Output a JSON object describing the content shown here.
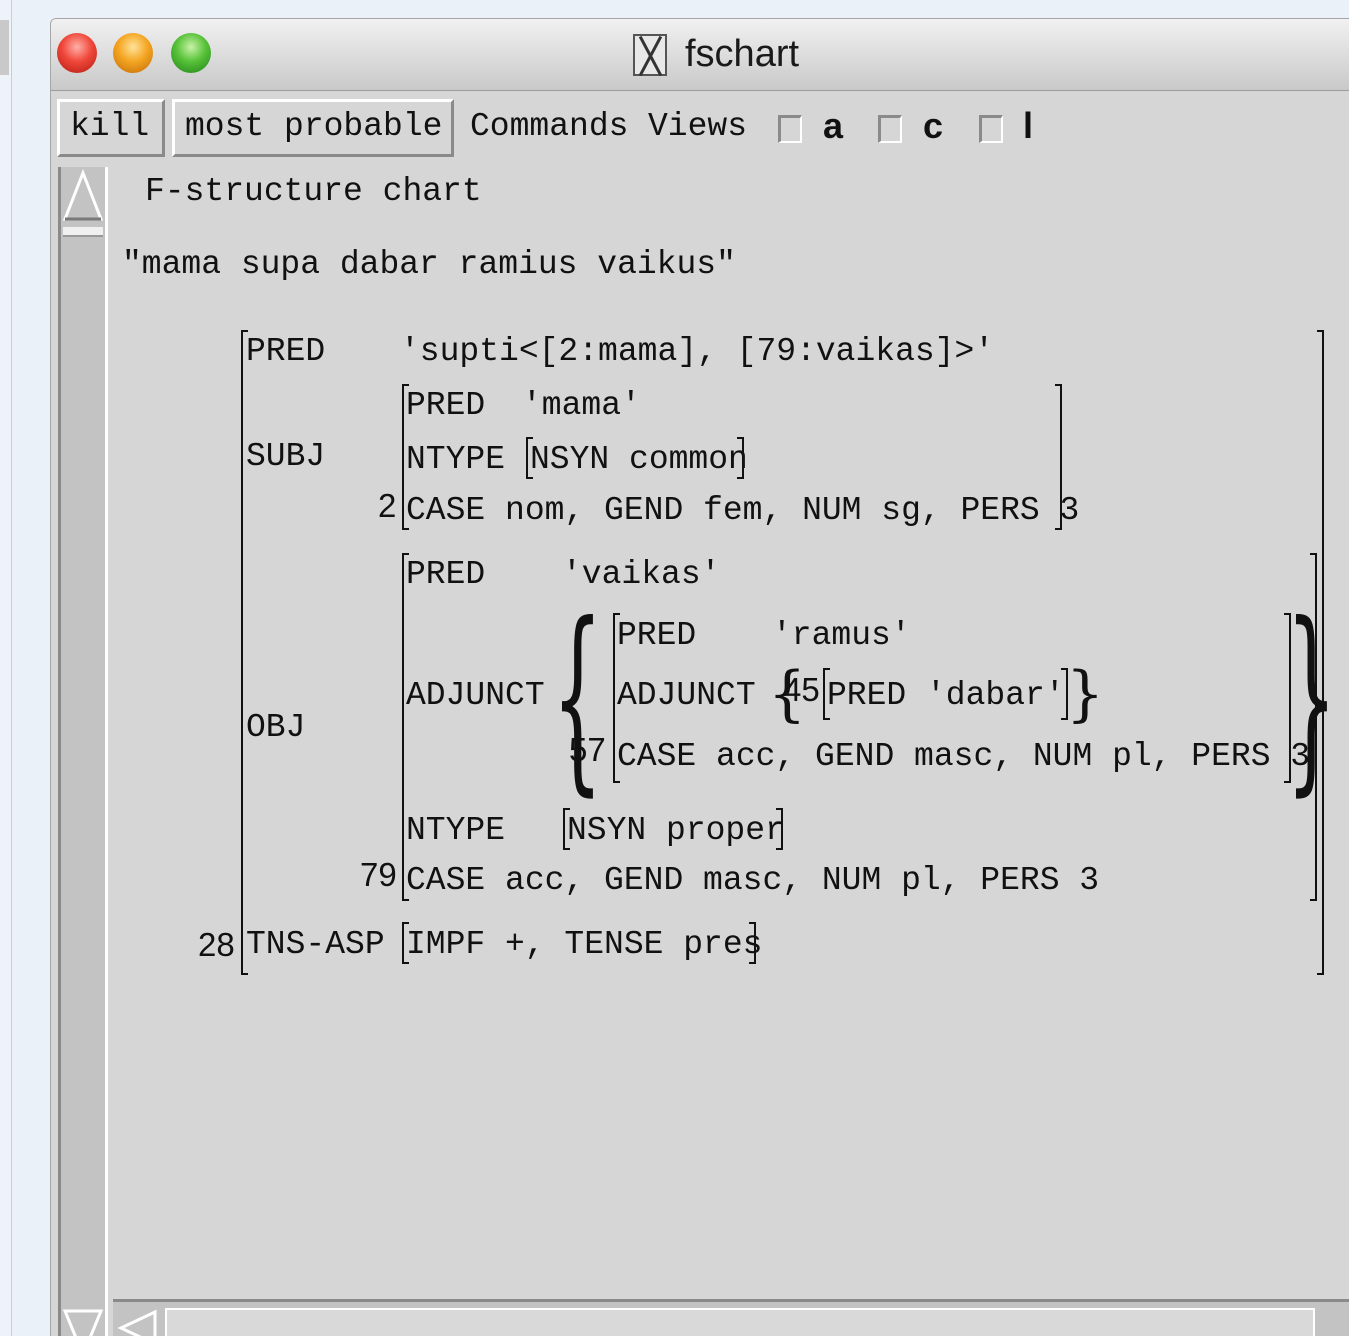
{
  "window": {
    "title": "fschart"
  },
  "toolbar": {
    "kill_label": "kill",
    "most_probable_label": "most probable",
    "commands_label": "Commands",
    "views_label": "Views",
    "checkboxes": [
      {
        "label": "a",
        "checked": false
      },
      {
        "label": "c",
        "checked": false
      },
      {
        "label": "l",
        "checked": false
      }
    ]
  },
  "content": {
    "heading": "F-structure chart",
    "sentence": "\"mama supa dabar ramius vaikus\"",
    "fstructure": {
      "outer_index": "28",
      "pred_attr": "PRED",
      "pred_value": "'supti<[2:mama], [79:vaikas]>'",
      "subj_attr": "SUBJ",
      "subj": {
        "index": "2",
        "pred_attr": "PRED",
        "pred_value": "'mama'",
        "ntype_attr": "NTYPE",
        "ntype_value": "NSYN common",
        "features": "CASE nom, GEND fem, NUM sg, PERS 3"
      },
      "obj_attr": "OBJ",
      "obj": {
        "index": "79",
        "pred_attr": "PRED",
        "pred_value": "'vaikas'",
        "adjunct_attr": "ADJUNCT",
        "adjunct": {
          "index": "57",
          "pred_attr": "PRED",
          "pred_value": "'ramus'",
          "adjunct_attr": "ADJUNCT",
          "inner_index": "45",
          "inner_pred_attr": "PRED",
          "inner_pred_value": "'dabar'",
          "features": "CASE acc, GEND masc, NUM pl, PERS 3"
        },
        "ntype_attr": "NTYPE",
        "ntype_value": "NSYN proper",
        "features": "CASE acc, GEND masc, NUM pl, PERS 3"
      },
      "tns_attr": "TNS-ASP",
      "tns_value": "IMPF +, TENSE pres"
    }
  }
}
